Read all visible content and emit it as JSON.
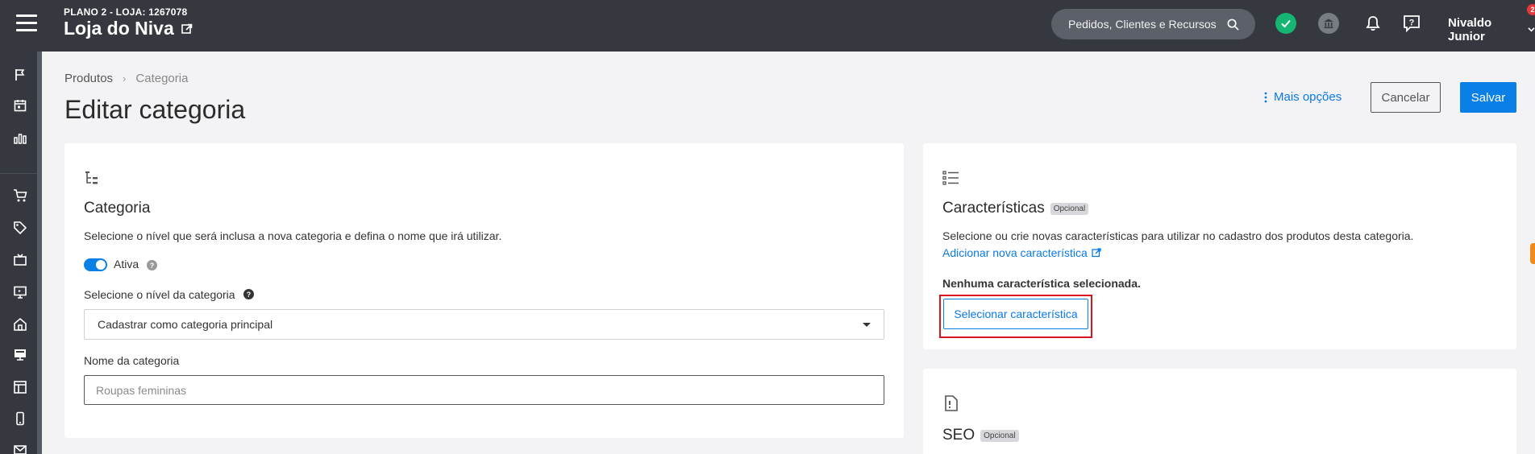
{
  "header": {
    "plan": "PLANO 2 - LOJA: 1267078",
    "store_name": "Loja do Niva",
    "search_placeholder": "Pedidos, Clientes e Recursos",
    "user_name": "Nivaldo Junior",
    "notification_count": "2",
    "status_ok_color": "#15b574"
  },
  "sidebar": {
    "icons": [
      "flag-icon",
      "calendar-icon",
      "bar-chart-icon",
      "cart-icon",
      "tag-icon",
      "tv-icon",
      "monitor-icon",
      "home-icon",
      "pos-icon",
      "layout-icon",
      "mobile-icon",
      "mail-icon"
    ]
  },
  "breadcrumb": {
    "parent": "Produtos",
    "current": "Categoria"
  },
  "page": {
    "title": "Editar categoria",
    "more_options": "Mais opções",
    "cancel": "Cancelar",
    "save": "Salvar"
  },
  "category_card": {
    "title": "Categoria",
    "description": "Selecione o nível que será inclusa a nova categoria e defina o nome que irá utilizar.",
    "toggle_label": "Ativa",
    "level_label": "Selecione o nível da categoria",
    "level_value": "Cadastrar como categoria principal",
    "name_label": "Nome da categoria",
    "name_placeholder": "Roupas femininas"
  },
  "features_card": {
    "title": "Características",
    "badge": "Opcional",
    "description": "Selecione ou crie novas características para utilizar no cadastro dos produtos desta categoria.",
    "add_link": "Adicionar nova característica",
    "empty_text": "Nenhuma característica selecionada.",
    "select_button": "Selecionar característica"
  },
  "seo_card": {
    "title": "SEO",
    "badge": "Opcional"
  },
  "colors": {
    "topbar": "#35383f",
    "primary": "#0a7fe6",
    "highlight": "#d8141e"
  }
}
